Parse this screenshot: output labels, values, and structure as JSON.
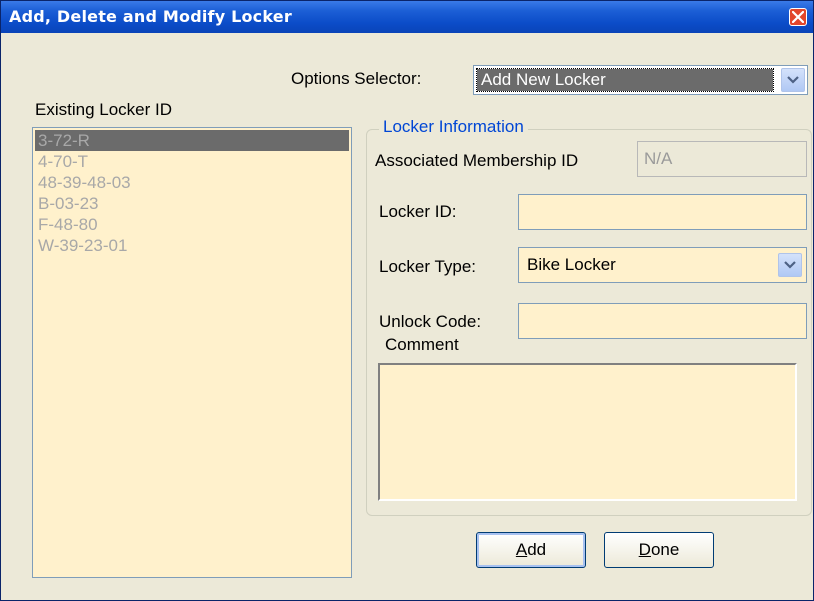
{
  "window": {
    "title": "Add, Delete and Modify Locker"
  },
  "options_selector": {
    "label": "Options Selector:",
    "value": "Add New Locker"
  },
  "existing_lockers": {
    "label": "Existing Locker ID",
    "items": [
      "3-72-R",
      "4-70-T",
      "48-39-48-03",
      "B-03-23",
      "F-48-80",
      "W-39-23-01"
    ],
    "selected_index": 0
  },
  "locker_info": {
    "group_title": "Locker Information",
    "membership_label": "Associated Membership ID",
    "membership_value": "N/A",
    "locker_id_label": "Locker ID:",
    "locker_id_value": "",
    "locker_type_label": "Locker Type:",
    "locker_type_value": "Bike Locker",
    "unlock_code_label": "Unlock Code:",
    "unlock_code_value": "",
    "comment_label": "Comment",
    "comment_value": ""
  },
  "buttons": {
    "add_mnemonic": "A",
    "add_rest": "dd",
    "done_mnemonic": "D",
    "done_rest": "one"
  },
  "icons": {
    "close": "close-icon",
    "dropdown": "chevron-down-icon"
  },
  "colors": {
    "title_bar": "#0b4cc8",
    "window_bg": "#ece9d8",
    "field_bg": "#fff1cc",
    "group_title": "#0046d5",
    "selection": "#6b6b6b"
  }
}
